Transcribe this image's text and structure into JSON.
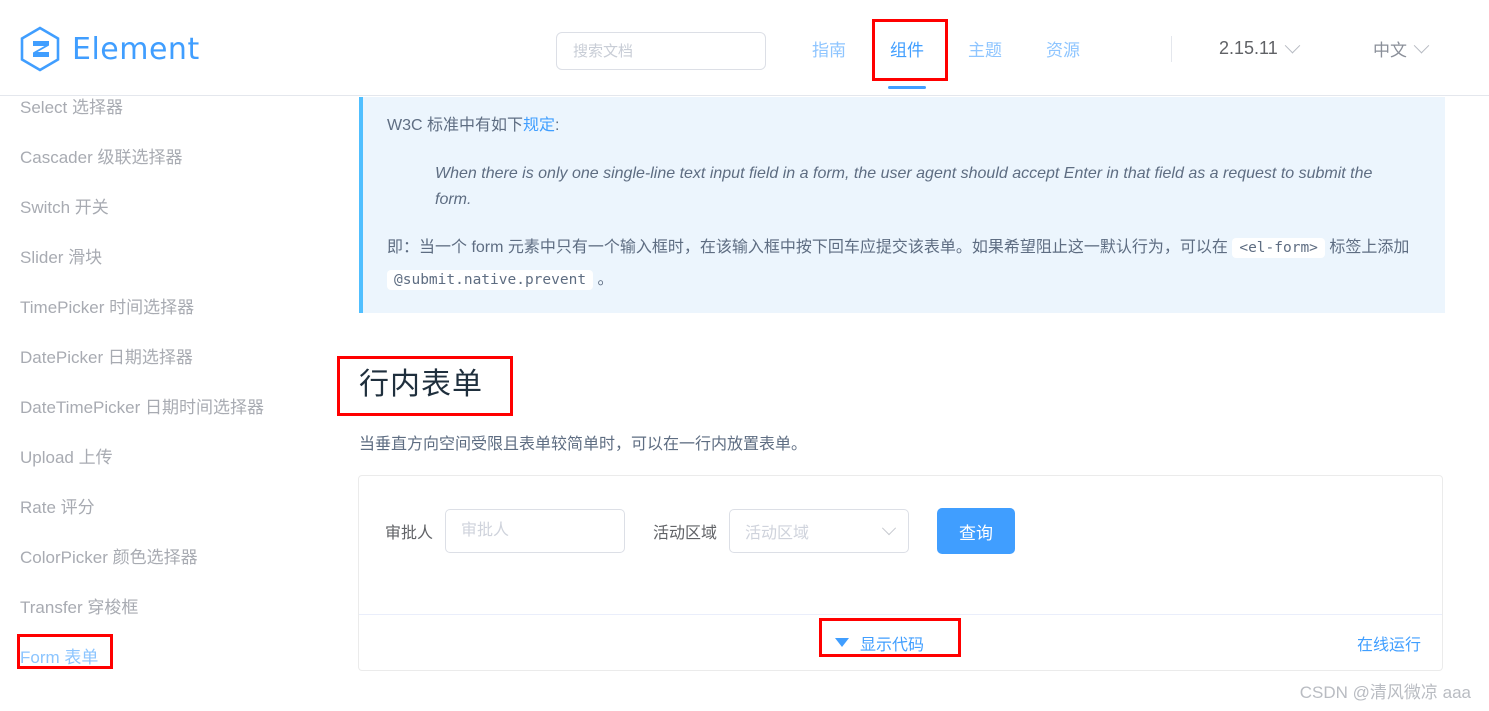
{
  "header": {
    "logo_text": "Element",
    "search": {
      "placeholder": "搜索文档",
      "value": ""
    },
    "nav": [
      {
        "label": "指南",
        "active": false
      },
      {
        "label": "组件",
        "active": true
      },
      {
        "label": "主题",
        "active": false
      },
      {
        "label": "资源",
        "active": false
      }
    ],
    "version": "2.15.11",
    "language": "中文"
  },
  "sidebar": {
    "items": [
      {
        "label": "Select 选择器",
        "active": false
      },
      {
        "label": "Cascader 级联选择器",
        "active": false
      },
      {
        "label": "Switch 开关",
        "active": false
      },
      {
        "label": "Slider 滑块",
        "active": false
      },
      {
        "label": "TimePicker 时间选择器",
        "active": false
      },
      {
        "label": "DatePicker 日期选择器",
        "active": false
      },
      {
        "label": "DateTimePicker 日期时间选择器",
        "active": false
      },
      {
        "label": "Upload 上传",
        "active": false
      },
      {
        "label": "Rate 评分",
        "active": false
      },
      {
        "label": "ColorPicker 颜色选择器",
        "active": false
      },
      {
        "label": "Transfer 穿梭框",
        "active": false
      },
      {
        "label": "Form 表单",
        "active": true
      }
    ]
  },
  "tip": {
    "line1_pre": "W3C 标准中有如下",
    "line1_link": "规定",
    "line1_post": ":",
    "quote": "When there is only one single-line text input field in a form, the user agent should accept Enter in that field as a request to submit the form.",
    "line2_a": "即：当一个 form 元素中只有一个输入框时，在该输入框中按下回车应提交该表单。如果希望阻止这一默认行为，可以在 ",
    "line2_code1": "<el-form>",
    "line2_b": " 标签上添加 ",
    "line2_code2": "@submit.native.prevent",
    "line2_c": " 。"
  },
  "section": {
    "title": "行内表单",
    "description": "当垂直方向空间受限且表单较简单时，可以在一行内放置表单。"
  },
  "demo": {
    "approver": {
      "label": "审批人",
      "placeholder": "审批人",
      "value": ""
    },
    "region": {
      "label": "活动区域",
      "placeholder": "活动区域",
      "value": ""
    },
    "submit_label": "查询",
    "show_code_label": "显示代码",
    "run_online_label": "在线运行"
  },
  "watermark": "CSDN @清风微凉 aaa",
  "colors": {
    "primary": "#409EFF",
    "annotation": "#FF0000",
    "tip_bg": "#ECF5FD"
  }
}
